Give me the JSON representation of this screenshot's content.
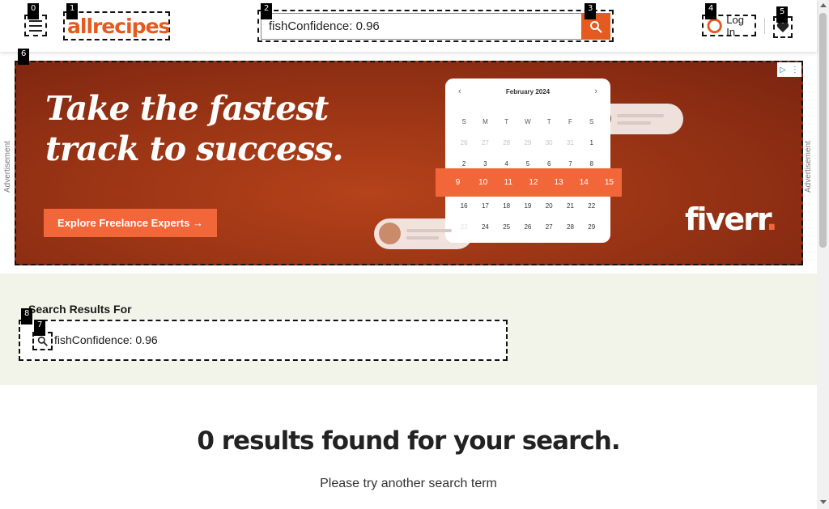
{
  "header": {
    "logo_text": "allrecipes",
    "search_value": "fishConfidence: 0.96",
    "login_label": "Log In"
  },
  "tags": [
    "0",
    "1",
    "2",
    "3",
    "4",
    "5",
    "6",
    "7",
    "8"
  ],
  "ad": {
    "side_label": "Advertisement",
    "headline_line1": "Take the fastest",
    "headline_line2": "track to success.",
    "cta_label": "Explore Freelance Experts →",
    "brand": "fiverr",
    "brand_dot": ".",
    "calendar": {
      "month": "February 2024",
      "weekdays": [
        "S",
        "M",
        "T",
        "W",
        "T",
        "F",
        "S"
      ],
      "weeks": [
        [
          "26",
          "27",
          "28",
          "29",
          "30",
          "31",
          "1"
        ],
        [
          "2",
          "3",
          "4",
          "5",
          "6",
          "7",
          "8"
        ],
        [
          "9",
          "10",
          "11",
          "12",
          "13",
          "14",
          "15"
        ],
        [
          "16",
          "17",
          "18",
          "19",
          "20",
          "21",
          "22"
        ],
        [
          "23",
          "24",
          "25",
          "26",
          "27",
          "28",
          "29"
        ]
      ],
      "highlight": [
        "9",
        "10",
        "11",
        "12",
        "13",
        "14",
        "15"
      ]
    },
    "accent_color": "#f2673a"
  },
  "results": {
    "title": "Search Results For",
    "term": "fishConfidence: 0.96",
    "no_results": "0 results found for your search.",
    "hint": "Please try another search term"
  },
  "colors": {
    "brand_orange": "#e55a1f",
    "band_bg": "#f2f4e9"
  }
}
